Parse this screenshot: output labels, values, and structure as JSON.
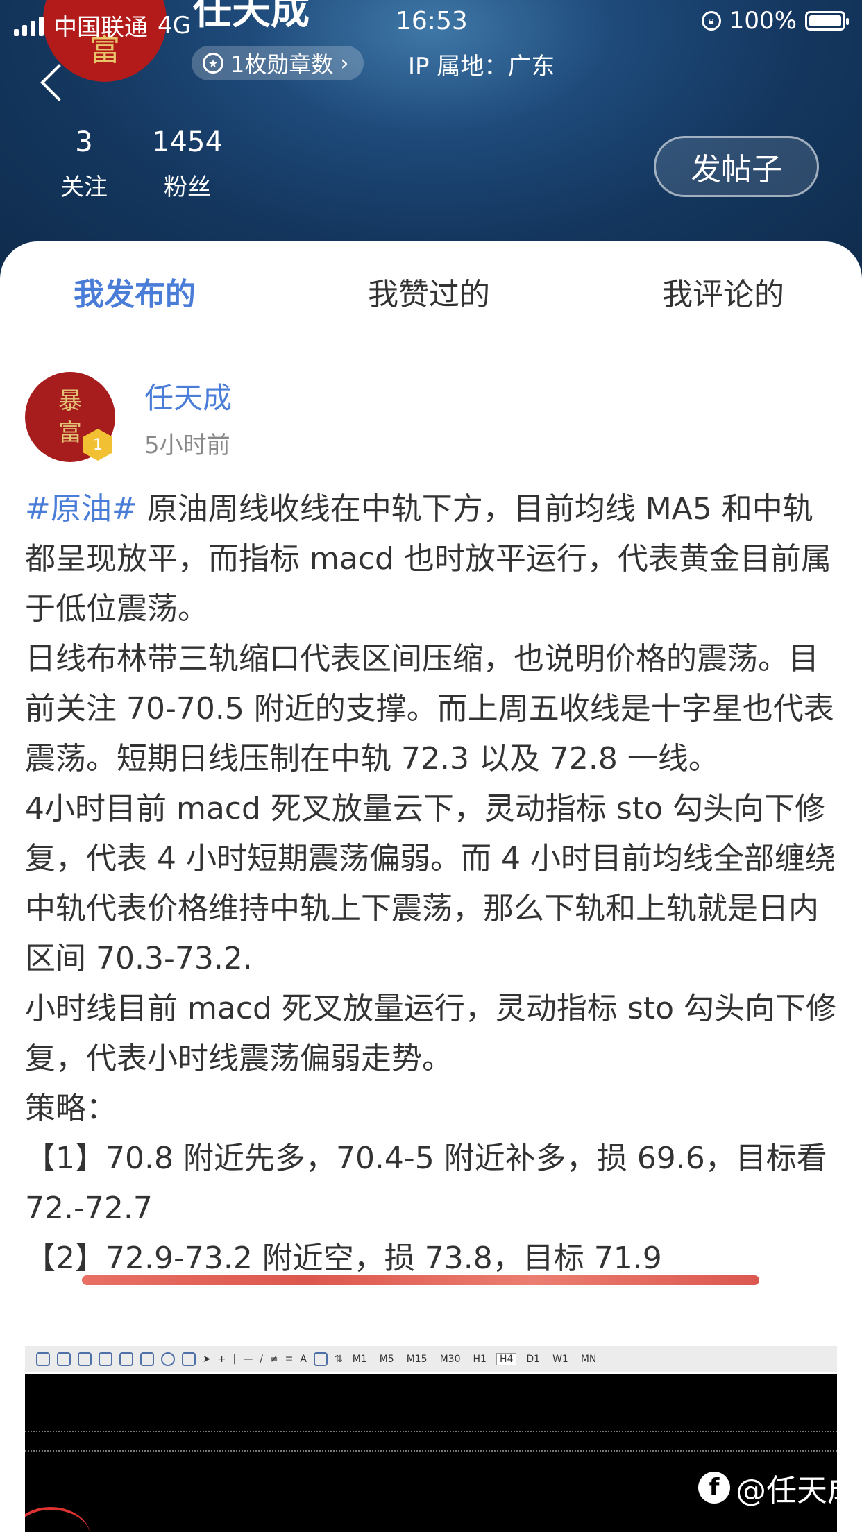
{
  "status_bar": {
    "carrier": "中国联通",
    "network": "4G",
    "time": "16:53",
    "battery": "100%"
  },
  "profile": {
    "name": "任天成",
    "avatar_text": "富",
    "medals": "1枚勋章数",
    "ip_location": "IP 属地：广东",
    "following_count": "3",
    "following_label": "关注",
    "fans_count": "1454",
    "fans_label": "粉丝",
    "post_button": "发帖子"
  },
  "tabs": [
    {
      "label": "我发布的",
      "active": true
    },
    {
      "label": "我赞过的",
      "active": false
    },
    {
      "label": "我评论的",
      "active": false
    }
  ],
  "post": {
    "author": "任天成",
    "avatar_line1": "暴",
    "avatar_line2": "富",
    "level": "1",
    "time": "5小时前",
    "hashtag": "#原油#",
    "p1": " 原油周线收线在中轨下方，目前均线 MA5 和中轨都呈现放平，而指标 macd 也时放平运行，代表黄金目前属于低位震荡。",
    "p2": "日线布林带三轨缩口代表区间压缩，也说明价格的震荡。目前关注 70-70.5 附近的支撑。而上周五收线是十字星也代表震荡。短期日线压制在中轨 72.3 以及 72.8 一线。",
    "p3": "4小时目前 macd 死叉放量云下，灵动指标 sto 勾头向下修复，代表 4 小时短期震荡偏弱。而 4 小时目前均线全部缠绕中轨代表价格维持中轨上下震荡，那么下轨和上轨就是日内区间 70.3-73.2.",
    "p4": "小时线目前 macd 死叉放量运行，灵动指标 sto 勾头向下修复，代表小时线震荡偏弱走势。",
    "p5": "策略：",
    "p6": "【1】70.8 附近先多，70.4-5 附近补多，损 69.6，目标看 72.-72.7",
    "p7": "【2】72.9-73.2 附近空，损 73.8，目标 71.9"
  },
  "chart_toolbar": {
    "timeframes": [
      "M1",
      "M5",
      "M15",
      "M30",
      "H1",
      "H4",
      "D1",
      "W1",
      "MN"
    ],
    "selected": "H4",
    "text_tool": "A"
  },
  "watermark": "@任天成"
}
